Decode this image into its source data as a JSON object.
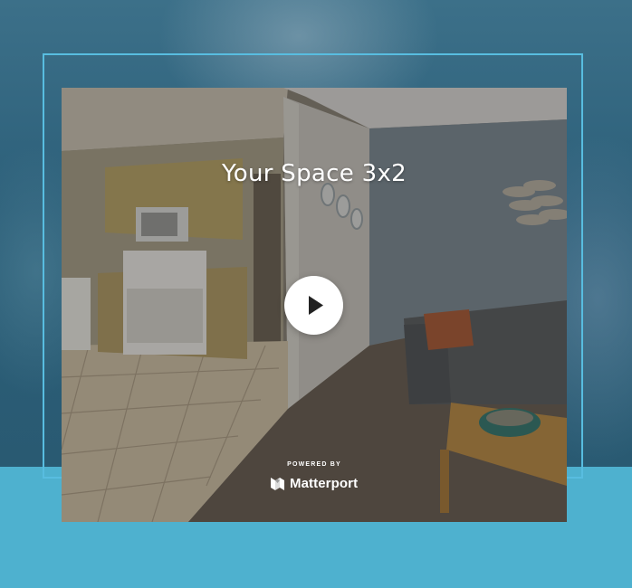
{
  "tour": {
    "title": "Your Space 3x2",
    "powered_by": "POWERED BY",
    "brand": "Matterport",
    "play_icon": "play-icon",
    "brand_icon": "matterport-logo-icon"
  },
  "colors": {
    "frame_border": "#58bde0",
    "bottom_band": "#4eb1cf",
    "backdrop": "#2f5f78"
  }
}
